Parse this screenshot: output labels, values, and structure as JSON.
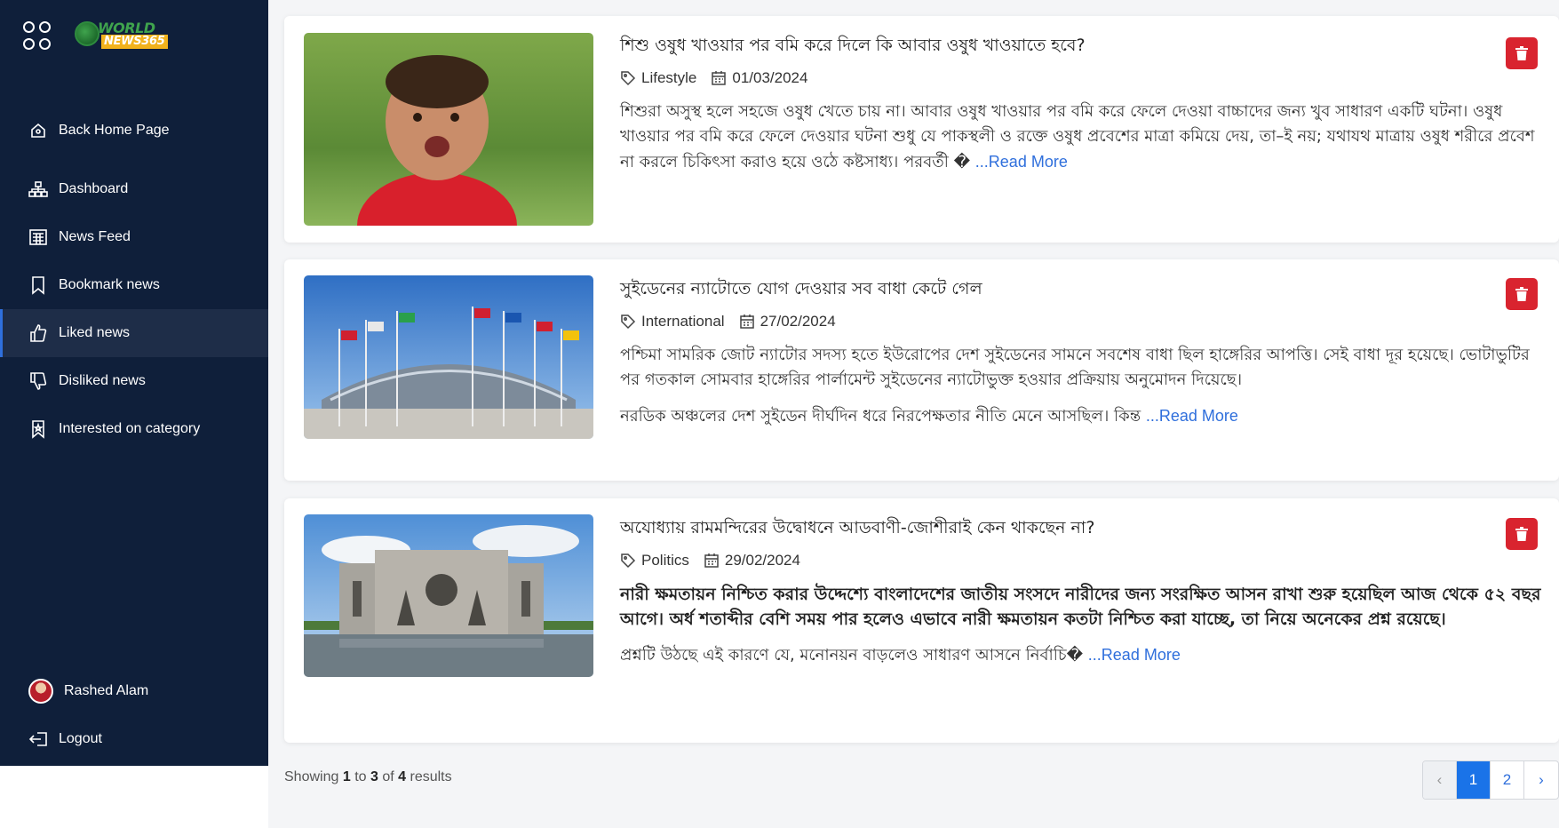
{
  "sidebar": {
    "logo": {
      "line1": "WORLD",
      "line2": "NEWS365"
    },
    "items": [
      {
        "label": "Back Home Page",
        "icon": "home-icon"
      },
      {
        "label": "Dashboard",
        "icon": "sitemap-icon"
      },
      {
        "label": "News Feed",
        "icon": "newspaper-icon"
      },
      {
        "label": "Bookmark news",
        "icon": "bookmark-icon"
      },
      {
        "label": "Liked news",
        "icon": "thumbs-up-icon",
        "active": true
      },
      {
        "label": "Disliked news",
        "icon": "thumbs-down-icon"
      },
      {
        "label": "Interested on category",
        "icon": "bookmark-star-icon"
      }
    ],
    "user": {
      "name": "Rashed Alam"
    },
    "logout_label": "Logout"
  },
  "articles": [
    {
      "title": "শিশু ওষুধ খাওয়ার পর বমি করে দিলে কি আবার ওষুধ খাওয়াতে হবে?",
      "category": "Lifestyle",
      "date": "01/03/2024",
      "excerpt": "শিশুরা অসুস্থ হলে সহজে ওষুধ খেতে চায় না। আবার ওষুধ খাওয়ার পর বমি করে ফেলে দেওয়া বাচ্চাদের জন্য খুব সাধারণ একটি ঘটনা। ওষুধ খাওয়ার পর বমি করে ফেলে দেওয়ার ঘটনা শুধু যে পাকস্থলী ও রক্তে ওষুধ প্রবেশের মাত্রা কমিয়ে দেয়, তা–ই নয়; যথাযথ মাত্রায় ওষুধ শরীরে প্রবেশ না করলে চিকিৎসা করাও হয়ে ওঠে কষ্টসাধ্য। পরবর্তী �",
      "read_more": "...Read More"
    },
    {
      "title": "সুইডেনের ন্যাটোতে যোগ দেওয়ার সব বাধা কেটে গেল",
      "category": "International",
      "date": "27/02/2024",
      "excerpt": "পশ্চিমা সামরিক জোট ন্যাটোর সদস্য হতে ইউরোপের দেশ সুইডেনের সামনে সবশেষ বাধা ছিল হাঙ্গেরির আপত্তি। সেই বাধা দূর হয়েছে। ভোটাভুটির পর গতকাল সোমবার হাঙ্গেরির পার্লামেন্ট সুইডেনের ন্যাটোভুক্ত হওয়ার প্রক্রিয়ায় অনুমোদন দিয়েছে।",
      "para2": "নরডিক অঞ্চলের দেশ সুইডেন দীর্ঘদিন ধরে নিরপেক্ষতার নীতি মেনে আসছিল। কিন্ত",
      "read_more": "...Read More"
    },
    {
      "title": "অযোধ্যায় রামমন্দিরের উদ্বোধনে আডবাণী-জোশীরাই কেন থাকছেন না?",
      "category": "Politics",
      "date": "29/02/2024",
      "excerpt": "নারী ক্ষমতায়ন নিশ্চিত করার উদ্দেশ্যে বাংলাদেশের জাতীয় সংসদে নারীদের জন্য সংরক্ষিত আসন রাখা শুরু হয়েছিল আজ থেকে ৫২ বছর আগে। অর্ধ শতাব্দীর বেশি সময় পার হলেও এভাবে নারী ক্ষমতায়ন কতটা নিশ্চিত করা যাচ্ছে, তা নিয়ে অনেকের প্রশ্ন রয়েছে।",
      "para2": "প্রশ্নটি উঠছে এই কারণে যে, মনোনয়ন বাড়লেও সাধারণ আসনে নির্বাচি�",
      "read_more": "...Read More"
    }
  ],
  "pagination": {
    "showing": "Showing",
    "from": "1",
    "to_word": "to",
    "to": "3",
    "of_word": "of",
    "total": "4",
    "results": "results",
    "prev": "‹",
    "pages": [
      "1",
      "2"
    ],
    "current": "1",
    "next": "›"
  },
  "colors": {
    "sidebar_bg": "#0f1f3a",
    "accent": "#1a73e8",
    "delete": "#d9242f",
    "link": "#2f6fdc"
  }
}
